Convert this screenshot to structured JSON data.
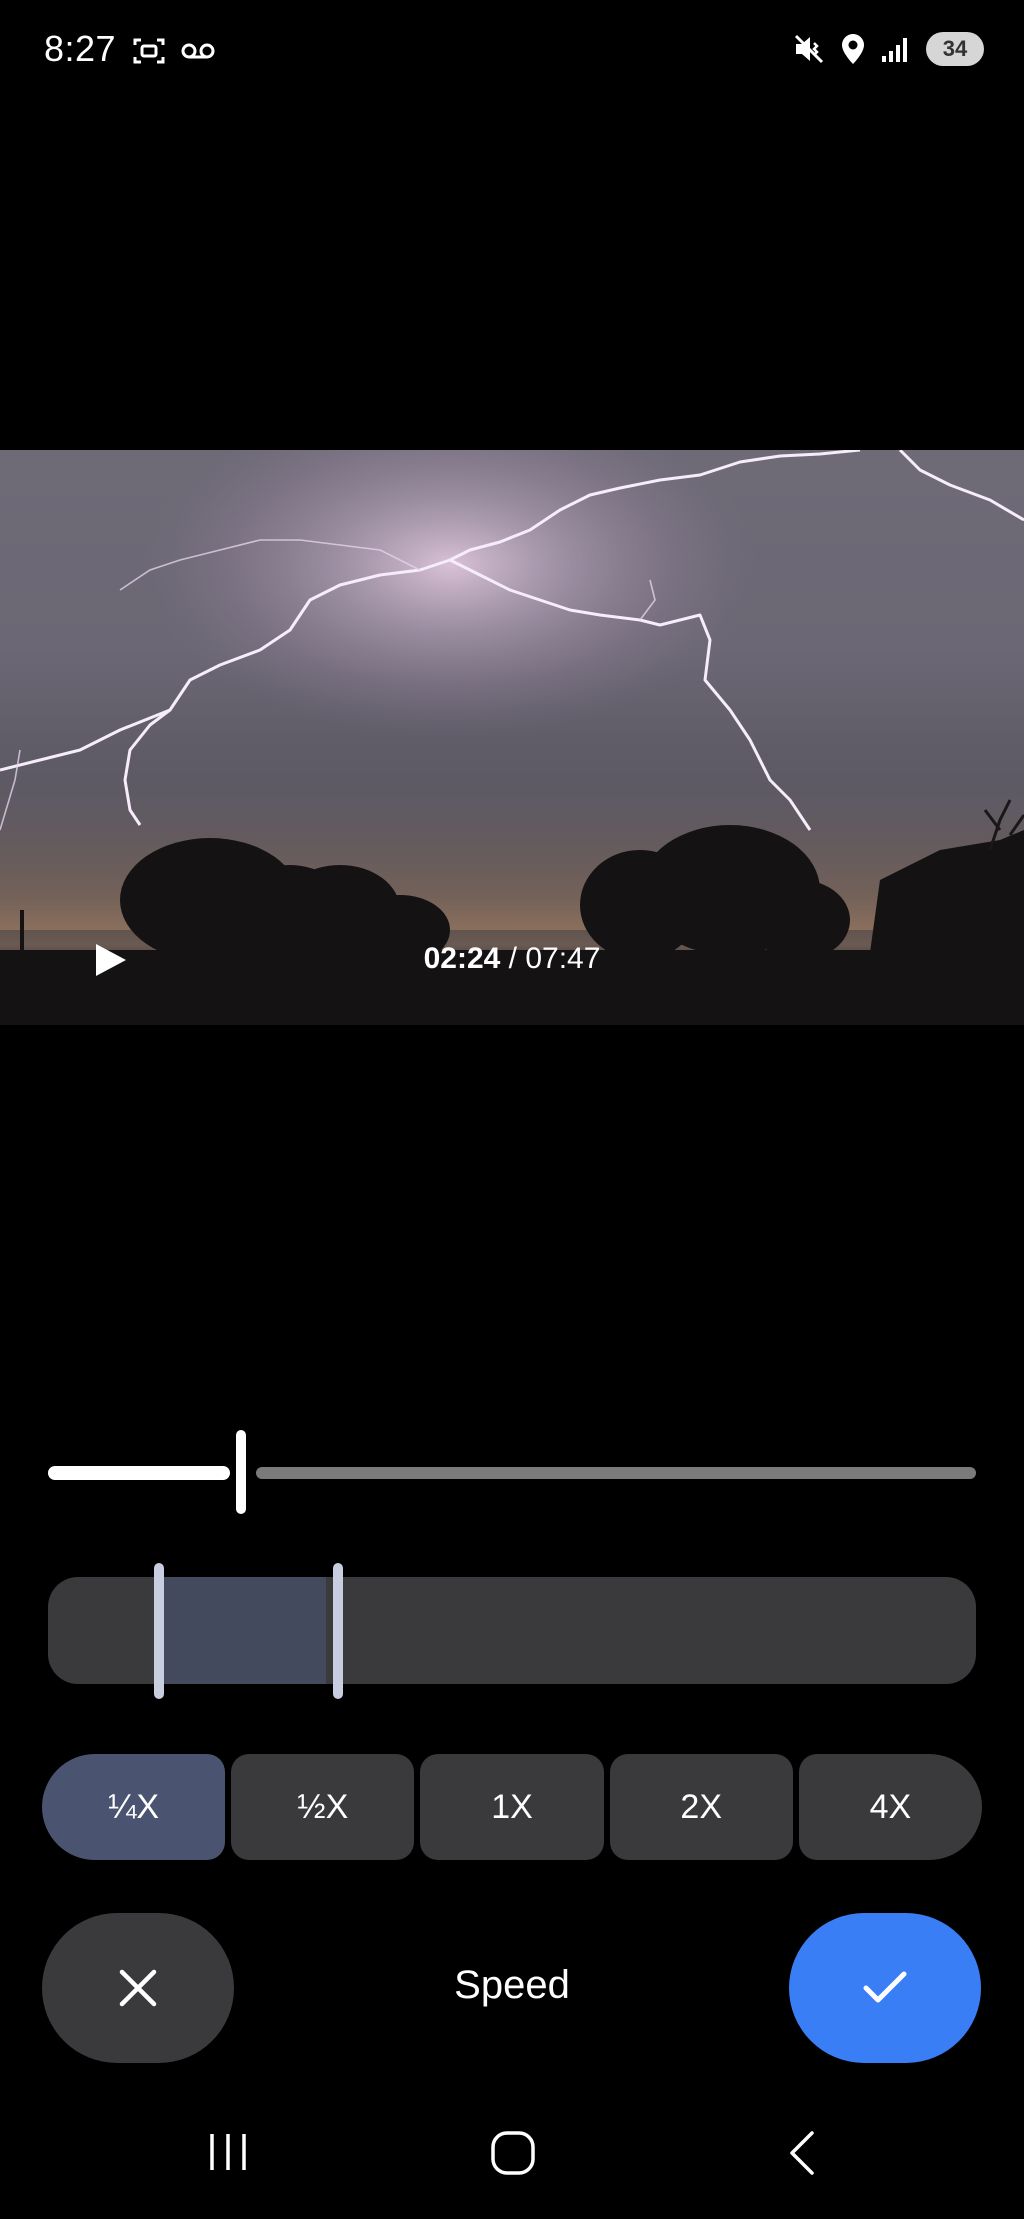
{
  "status_bar": {
    "time": "8:27",
    "left_icons": [
      "screenshot-icon",
      "voicemail-icon"
    ],
    "right_icons": [
      "mute-vibrate-icon",
      "location-icon",
      "signal-icon"
    ],
    "battery": "34"
  },
  "video": {
    "current_time": "02:24",
    "separator": " / ",
    "total_time": "07:47",
    "play_icon": "play-icon"
  },
  "scrubber": {
    "progress": 0.31
  },
  "range_selector": {
    "start_fraction": 0.12,
    "end_fraction": 0.31
  },
  "speed_options": [
    {
      "label": "¼X",
      "selected": true
    },
    {
      "label": "½X",
      "selected": false
    },
    {
      "label": "1X",
      "selected": false
    },
    {
      "label": "2X",
      "selected": false
    },
    {
      "label": "4X",
      "selected": false
    }
  ],
  "actions": {
    "mode_label": "Speed",
    "cancel_icon": "close-icon",
    "confirm_icon": "check-icon"
  },
  "nav_bar": {
    "items": [
      "recent-apps-icon",
      "home-icon",
      "back-icon"
    ]
  },
  "colors": {
    "background": "#000000",
    "accent": "#3a7ef6",
    "selected_chip": "#4a5470",
    "chip": "#3a3a3c"
  }
}
